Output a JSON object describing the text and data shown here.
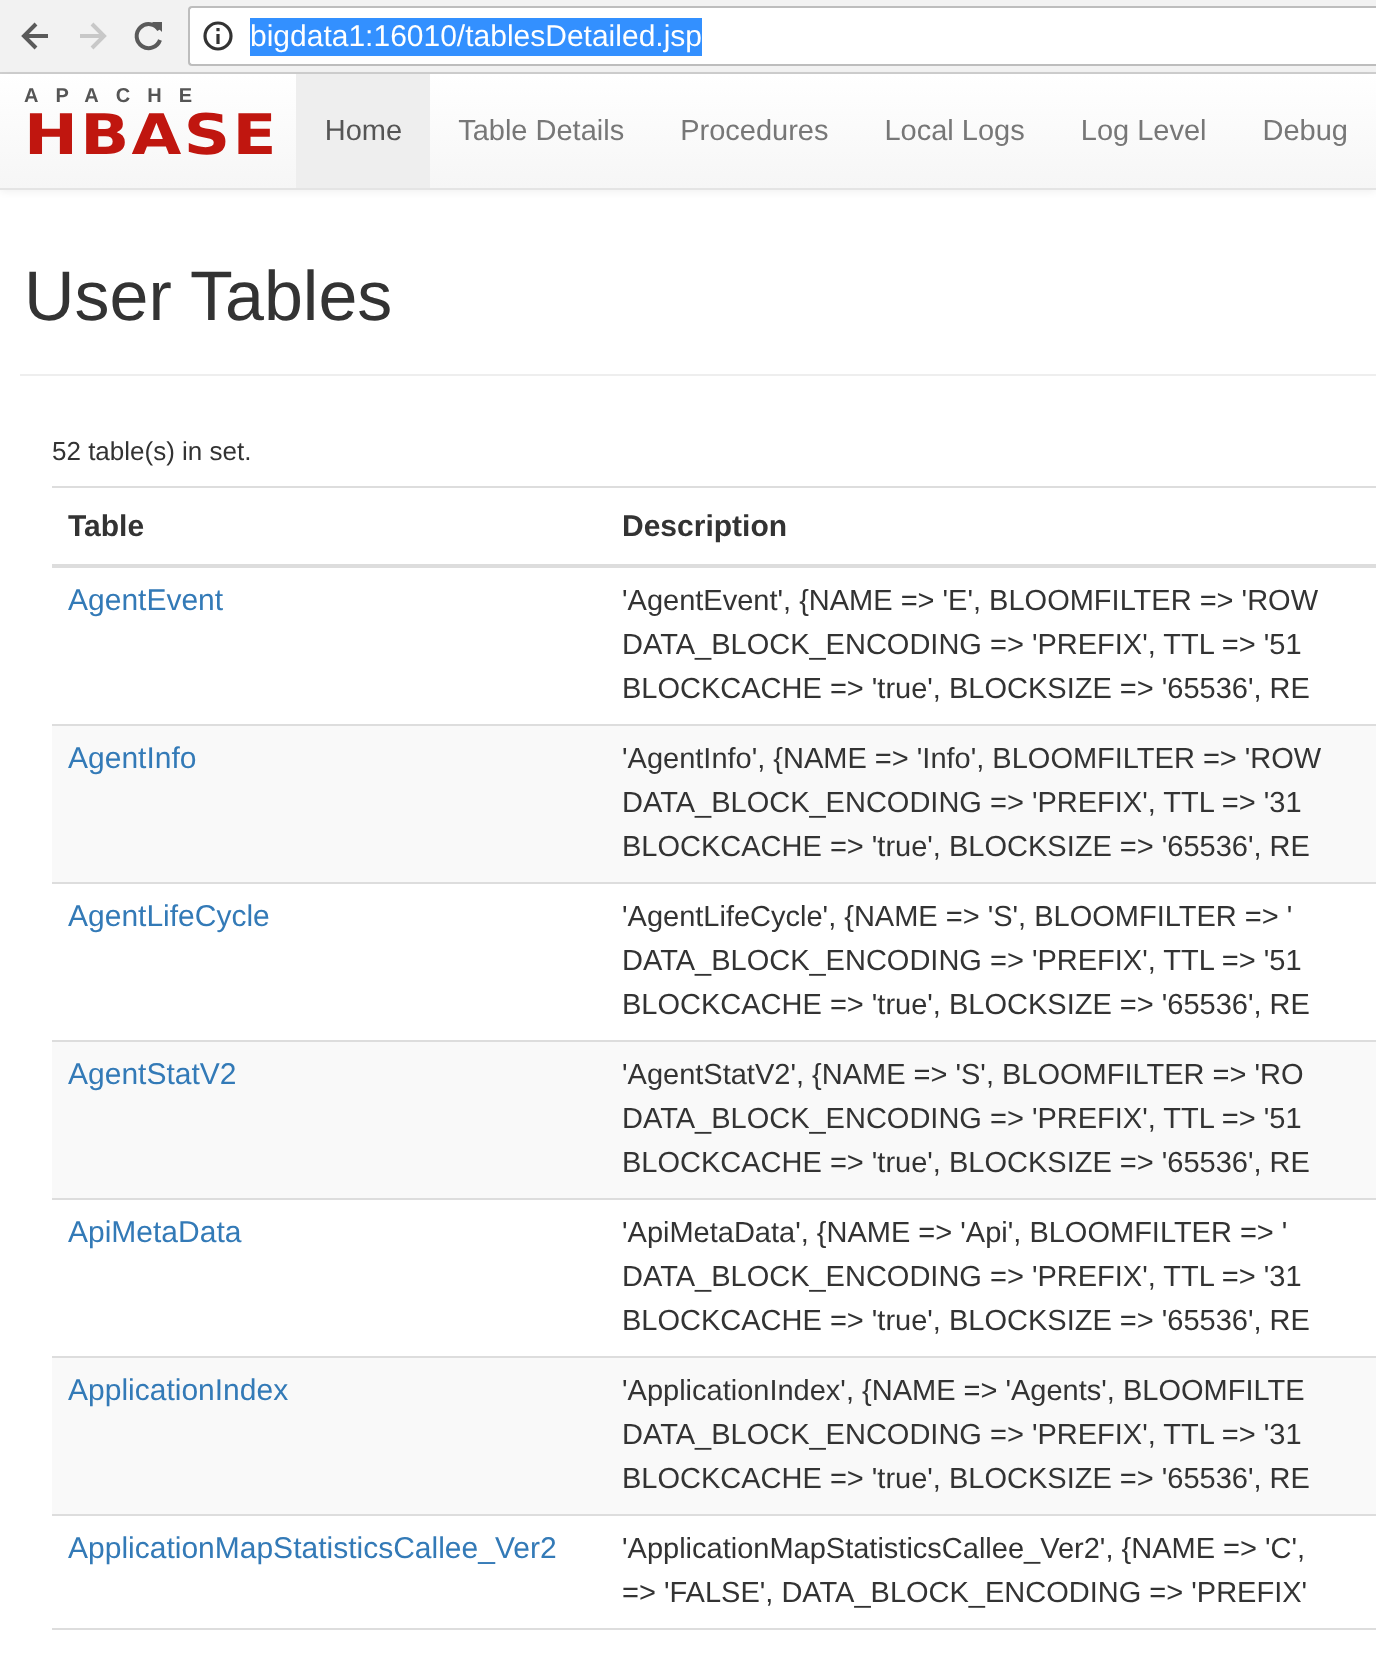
{
  "browser": {
    "back_enabled": true,
    "forward_enabled": false,
    "url": "bigdata1:16010/tablesDetailed.jsp",
    "url_selected": true
  },
  "logo": {
    "top": "APACHE",
    "main": "HBASE"
  },
  "nav": [
    {
      "label": "Home",
      "selected": true
    },
    {
      "label": "Table Details",
      "selected": false
    },
    {
      "label": "Procedures",
      "selected": false
    },
    {
      "label": "Local Logs",
      "selected": false
    },
    {
      "label": "Log Level",
      "selected": false
    },
    {
      "label": "Debug",
      "selected": false
    }
  ],
  "heading": "User Tables",
  "count": "52 table(s) in set.",
  "table": {
    "columns": [
      "Table",
      "Description"
    ],
    "rows": [
      {
        "name": "AgentEvent",
        "description": [
          "'AgentEvent', {NAME => 'E', BLOOMFILTER => 'ROW",
          "DATA_BLOCK_ENCODING => 'PREFIX', TTL => '51",
          "BLOCKCACHE => 'true', BLOCKSIZE => '65536', RE"
        ]
      },
      {
        "name": "AgentInfo",
        "description": [
          "'AgentInfo', {NAME => 'Info', BLOOMFILTER => 'ROW",
          "DATA_BLOCK_ENCODING => 'PREFIX', TTL => '31",
          "BLOCKCACHE => 'true', BLOCKSIZE => '65536', RE"
        ]
      },
      {
        "name": "AgentLifeCycle",
        "description": [
          "'AgentLifeCycle', {NAME => 'S', BLOOMFILTER => '",
          "DATA_BLOCK_ENCODING => 'PREFIX', TTL => '51",
          "BLOCKCACHE => 'true', BLOCKSIZE => '65536', RE"
        ]
      },
      {
        "name": "AgentStatV2",
        "description": [
          "'AgentStatV2', {NAME => 'S', BLOOMFILTER => 'RO",
          "DATA_BLOCK_ENCODING => 'PREFIX', TTL => '51",
          "BLOCKCACHE => 'true', BLOCKSIZE => '65536', RE"
        ]
      },
      {
        "name": "ApiMetaData",
        "description": [
          "'ApiMetaData', {NAME => 'Api', BLOOMFILTER => '",
          "DATA_BLOCK_ENCODING => 'PREFIX', TTL => '31",
          "BLOCKCACHE => 'true', BLOCKSIZE => '65536', RE"
        ]
      },
      {
        "name": "ApplicationIndex",
        "description": [
          "'ApplicationIndex', {NAME => 'Agents', BLOOMFILTE",
          "DATA_BLOCK_ENCODING => 'PREFIX', TTL => '31",
          "BLOCKCACHE => 'true', BLOCKSIZE => '65536', RE"
        ]
      },
      {
        "name": "ApplicationMapStatisticsCallee_Ver2",
        "description": [
          "'ApplicationMapStatisticsCallee_Ver2', {NAME => 'C',",
          "=> 'FALSE', DATA_BLOCK_ENCODING => 'PREFIX'"
        ]
      }
    ]
  }
}
